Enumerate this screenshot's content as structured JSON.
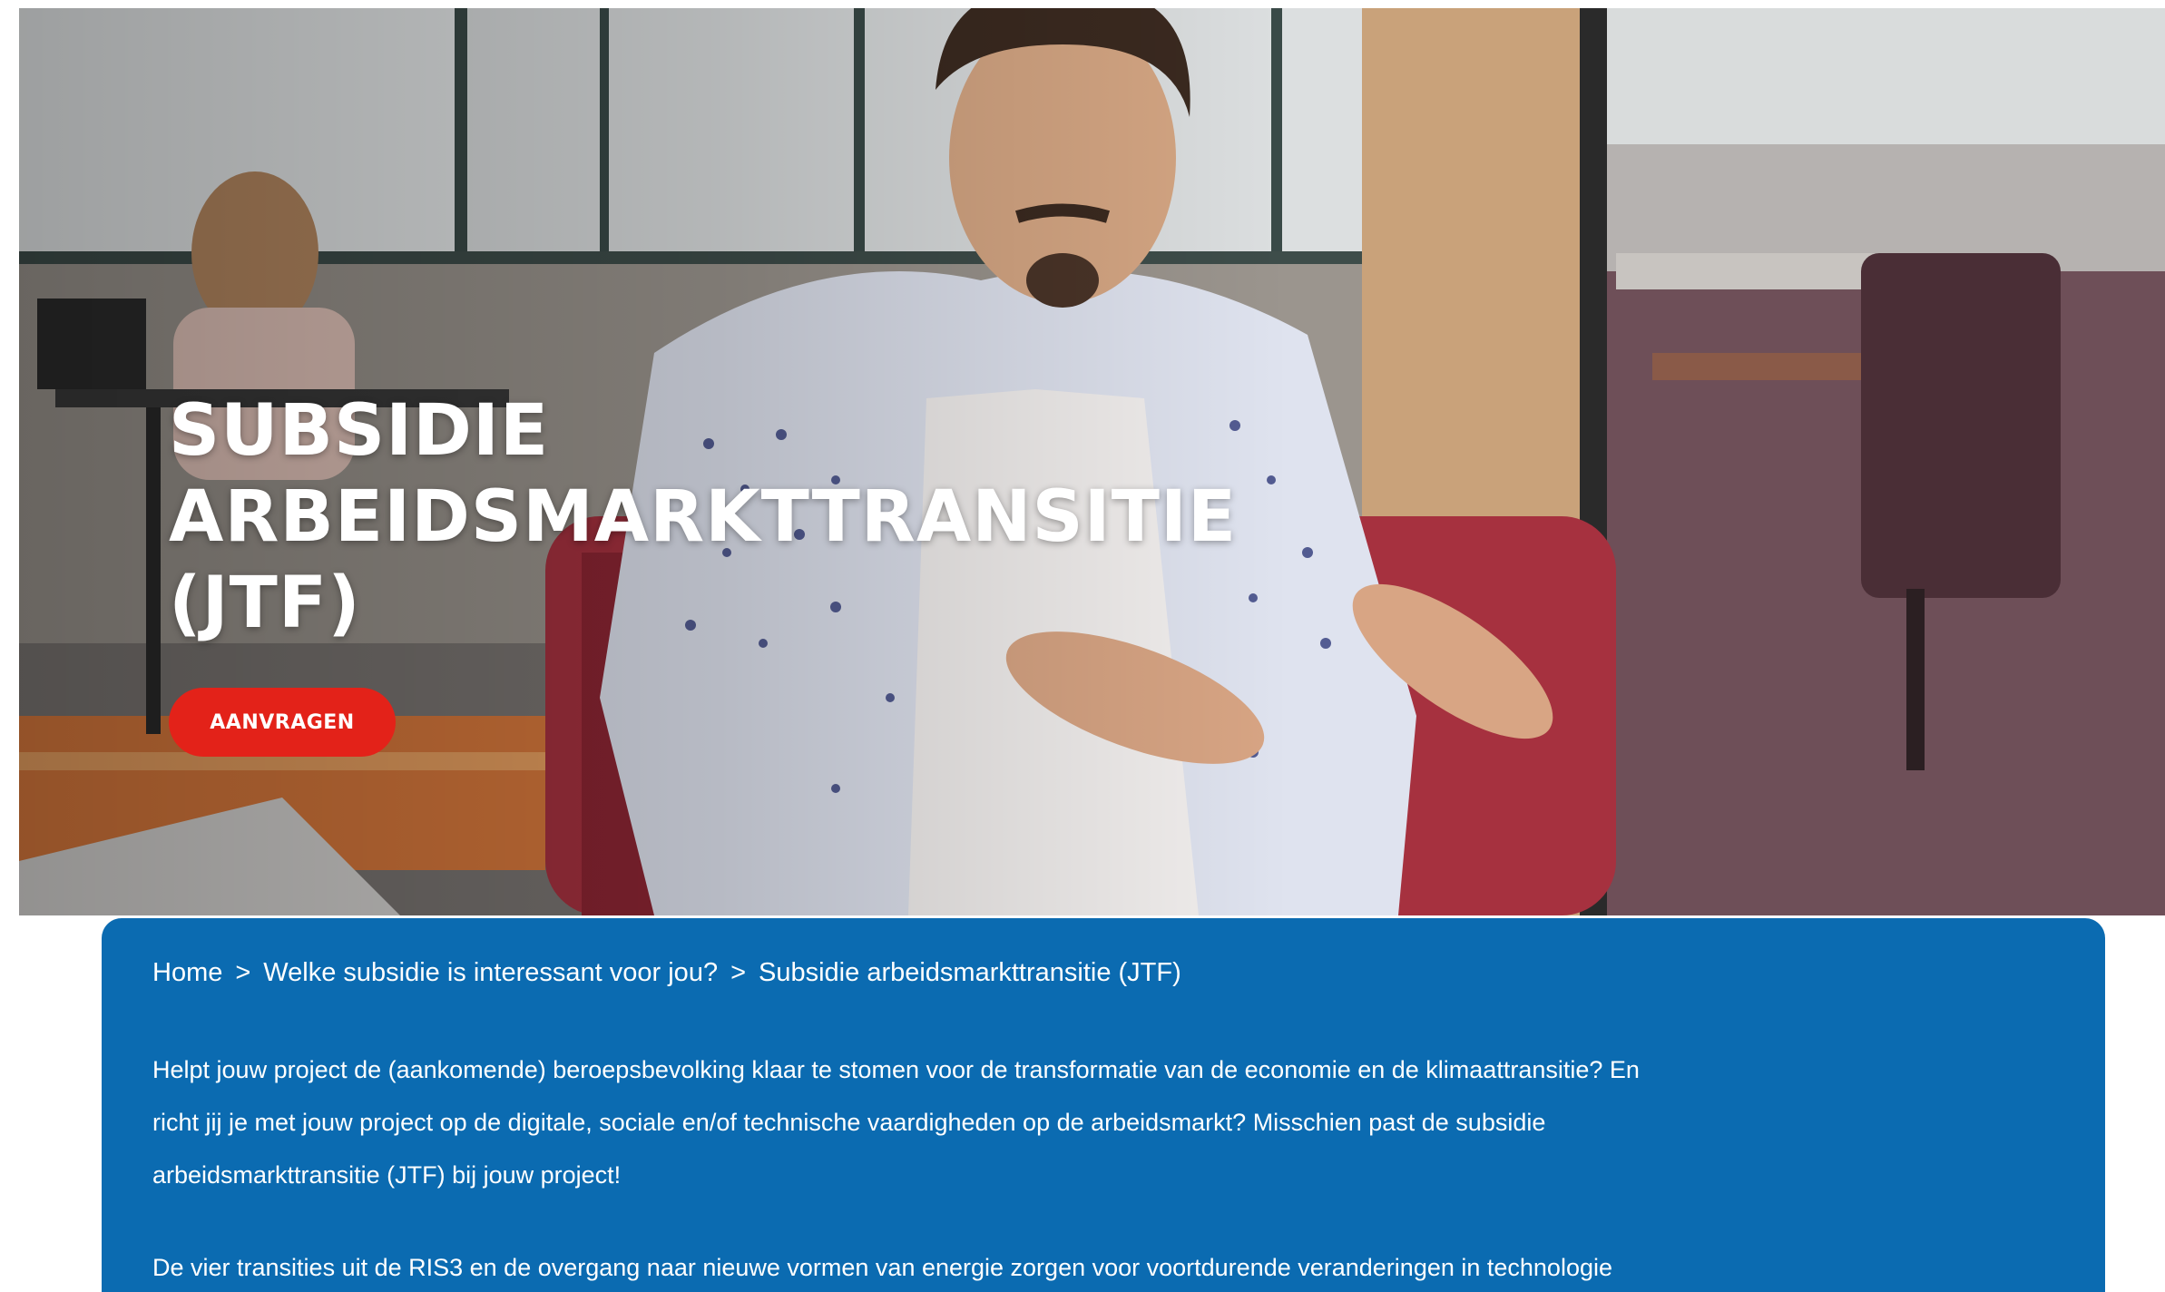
{
  "hero": {
    "title_lines": [
      "SUBSIDIE",
      "ARBEIDSMARKTTRANSITIE",
      "(JTF)"
    ],
    "cta_label": "AANVRAGEN",
    "accent_color": "#e32219"
  },
  "breadcrumb": {
    "items": [
      "Home",
      "Welke subsidie is interessant voor jou?",
      "Subsidie arbeidsmarkttransitie (JTF)"
    ],
    "separator": ">"
  },
  "content": {
    "card_color": "#0b6bb1",
    "intro_lines": [
      "Helpt jouw project de (aankomende) beroepsbevolking klaar te stomen voor de transformatie van de economie en de klimaattransitie? En",
      "richt jij je met jouw project op de digitale, sociale en/of technische vaardigheden op de arbeidsmarkt? Misschien past de subsidie",
      "arbeidsmarkttransitie (JTF) bij jouw project!"
    ],
    "second_paragraph": "De vier transities uit de RIS3 en de overgang naar nieuwe vormen van energie zorgen voor voortdurende veranderingen in technologie"
  }
}
